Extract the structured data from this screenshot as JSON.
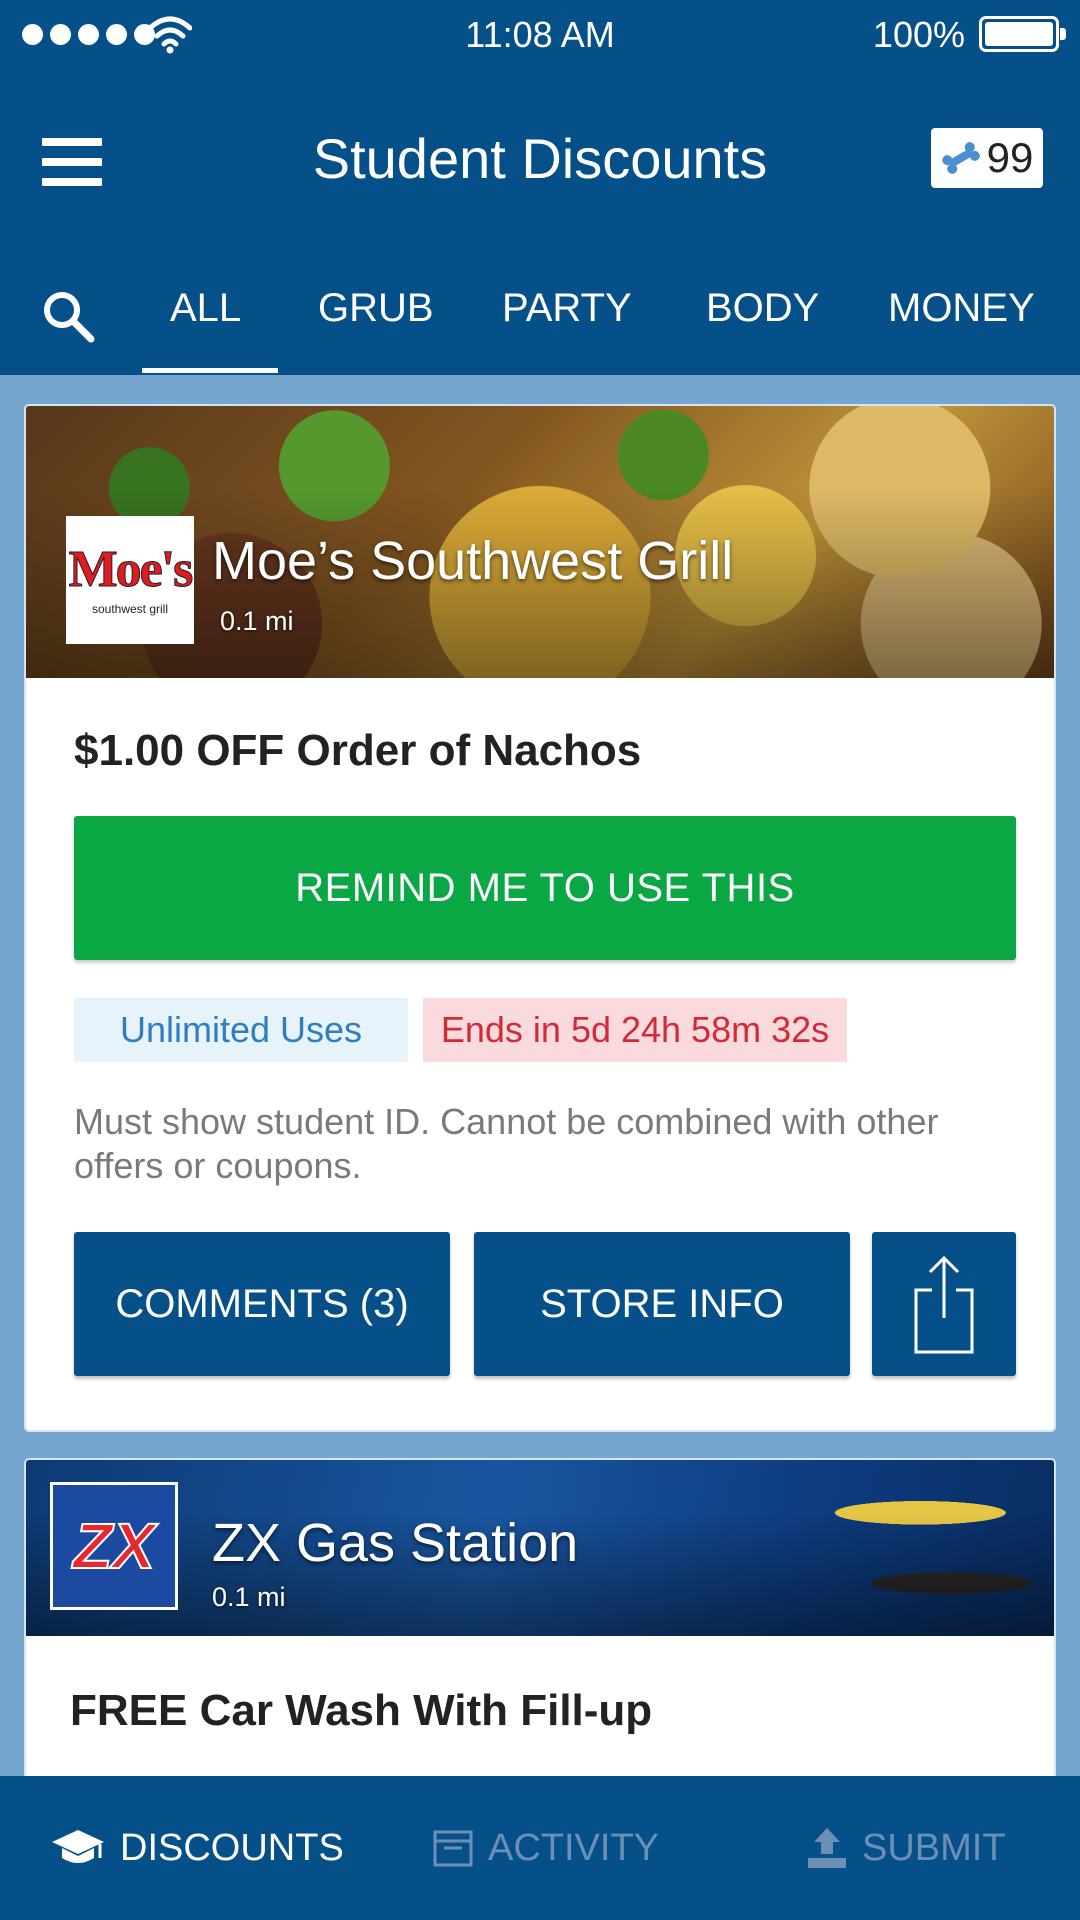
{
  "status_bar": {
    "time": "11:08 AM",
    "battery": "100%"
  },
  "header": {
    "title": "Student Discounts",
    "points": "99"
  },
  "tabs": [
    {
      "label": "ALL",
      "active": true
    },
    {
      "label": "GRUB",
      "active": false
    },
    {
      "label": "PARTY",
      "active": false
    },
    {
      "label": "BODY",
      "active": false
    },
    {
      "label": "MONEY",
      "active": false
    }
  ],
  "deals": [
    {
      "store_name": "Moe’s Southwest Grill",
      "distance": "0.1 mi",
      "logo_text": "Moe's",
      "logo_subtext": "southwest grill",
      "title": "$1.00 OFF Order of Nachos",
      "remind_label": "REMIND ME TO USE THIS",
      "uses_badge": "Unlimited Uses",
      "ends_badge": "Ends in 5d 24h 58m 32s",
      "terms": "Must show student ID. Cannot be combined with other offers or coupons.",
      "comments_label": "COMMENTS (3)",
      "store_info_label": "STORE INFO"
    },
    {
      "store_name": "ZX Gas Station",
      "distance": "0.1 mi",
      "logo_text": "ZX",
      "title": "FREE Car Wash With Fill-up"
    }
  ],
  "bottom_nav": [
    {
      "label": "DISCOUNTS",
      "icon": "graduation-cap-icon",
      "active": true
    },
    {
      "label": "ACTIVITY",
      "icon": "calendar-icon",
      "active": false
    },
    {
      "label": "SUBMIT",
      "icon": "upload-icon",
      "active": false
    }
  ],
  "colors": {
    "primary": "#06508a",
    "background": "#74a6cf",
    "remind_green": "#0aa845",
    "uses_text": "#2f7ec1",
    "ends_text": "#d22a36"
  }
}
